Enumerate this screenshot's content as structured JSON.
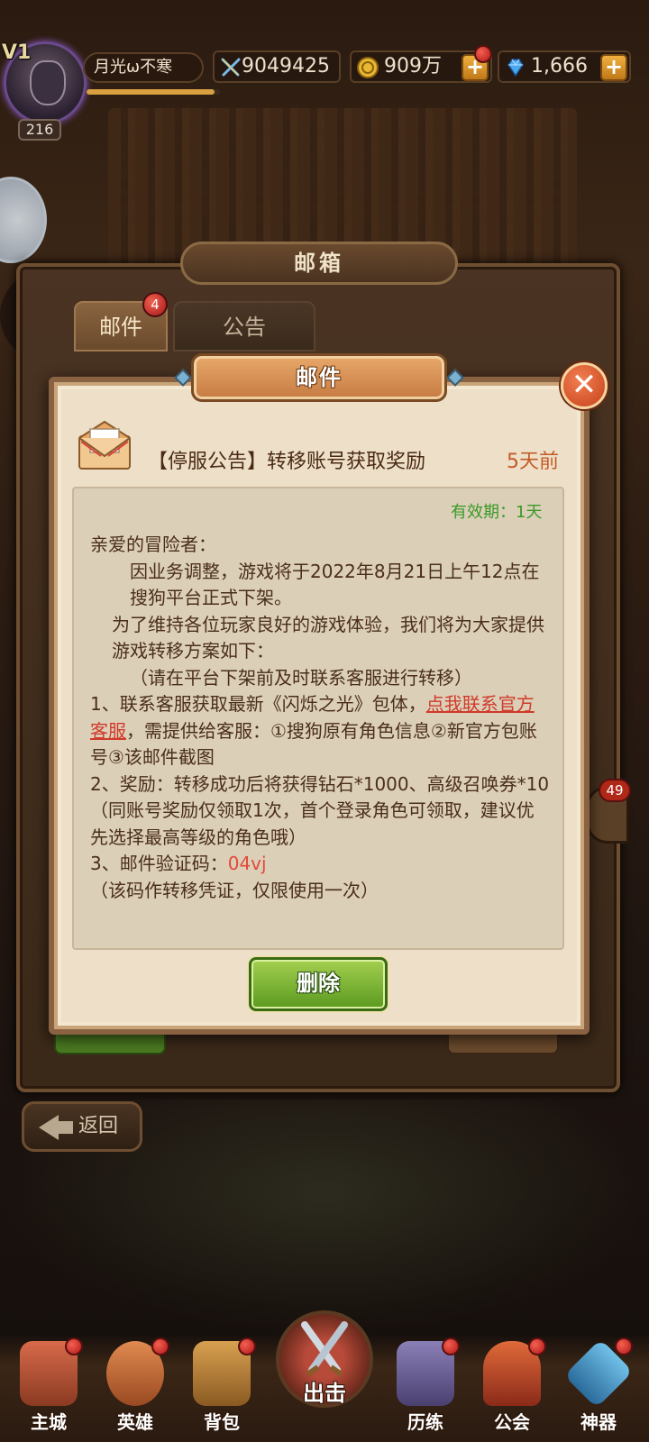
{
  "player": {
    "vip_label": "V1",
    "name": "月光ω不寒",
    "level": "216",
    "exp_fraction": 0.96
  },
  "resources": {
    "power": "9049425",
    "gold": "909万",
    "gems": "1,666",
    "plus_label": "+"
  },
  "mailbox": {
    "title": "邮箱",
    "tabs": [
      {
        "label": "邮件",
        "badge": "4"
      },
      {
        "label": "公告"
      }
    ],
    "side_badge": "49",
    "back_label": "返回"
  },
  "mail_dialog": {
    "title": "邮件",
    "close_label": "✕",
    "subject": "【停服公告】转移账号获取奖励",
    "time": "5天前",
    "validity": "有效期：1天",
    "body": {
      "greeting": "亲爱的冒险者：",
      "p1": "因业务调整，游戏将于2022年8月21日上午12点在搜狗平台正式下架。",
      "p2": "为了维持各位玩家良好的游戏体验，我们将为大家提供游戏转移方案如下：",
      "p3": "（请在平台下架前及时联系客服进行转移）",
      "item1_pre": "1、联系客服获取最新《闪烁之光》包体，",
      "item1_link": "点我联系官方客服",
      "item1_post": "，需提供给客服：①搜狗原有角色信息②新官方包账号③该邮件截图",
      "item2": "2、奖励：转移成功后将获得钻石*1000、高级召唤券*10（同账号奖励仅领取1次，首个登录角色可领取，建议优先选择最高等级的角色哦）",
      "item3_pre": "3、邮件验证码：",
      "item3_code": "04vj",
      "item3_post": "（该码作转移凭证，仅限使用一次）"
    },
    "delete_label": "删除"
  },
  "bottom_nav": {
    "items": [
      "主城",
      "英雄",
      "背包",
      "出击",
      "历练",
      "公会",
      "神器"
    ]
  },
  "colors": {
    "accent_orange": "#c45a28",
    "validity_green": "#3a9a28",
    "link_red": "#d03a2a"
  }
}
